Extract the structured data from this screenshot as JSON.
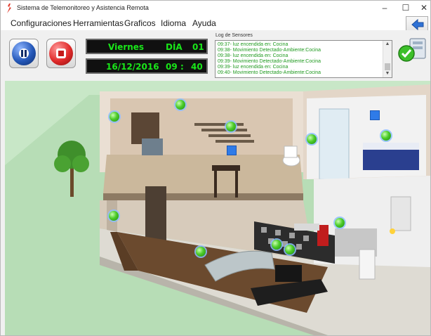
{
  "window": {
    "title": "Sistema de Telemonitoreo y Asistencia Remota",
    "minimize_label": "–",
    "maximize_label": "☐",
    "close_label": "✕"
  },
  "menu": {
    "items": [
      {
        "label": "Configuraciones"
      },
      {
        "label": "Herramientas"
      },
      {
        "label": "Graficos"
      },
      {
        "label": "Idioma"
      },
      {
        "label": "Ayuda"
      }
    ]
  },
  "toolbar": {
    "pause_icon": "pause-icon",
    "stop_icon": "stop-icon",
    "back_icon": "back-arrow-icon",
    "status_icon": "check-database-icon"
  },
  "clock": {
    "day_name": "Viernes",
    "day_label": "DÍA",
    "day_number": "01",
    "date": "16/12/2016",
    "hour": "09",
    "separator": ":",
    "minute": "40"
  },
  "sensor_log": {
    "label": "Log de Sensores",
    "entries": [
      "09:37- luz encendida en: Cocina",
      "09:38- Movimiento Detectado-Ambiente:Cocina",
      "09:38- luz encendida en: Cocina",
      "09:39- Movimiento Detectado-Ambiente:Cocina",
      "09:39- luz encendida en: Cocina",
      "09:40- Movimiento Detectado-Ambiente:Cocina"
    ]
  },
  "colors": {
    "display_text": "#19e619",
    "log_text": "#1f9a1f",
    "sensor_on": "#4dcc2a",
    "sensor_square": "#2f7be8"
  }
}
